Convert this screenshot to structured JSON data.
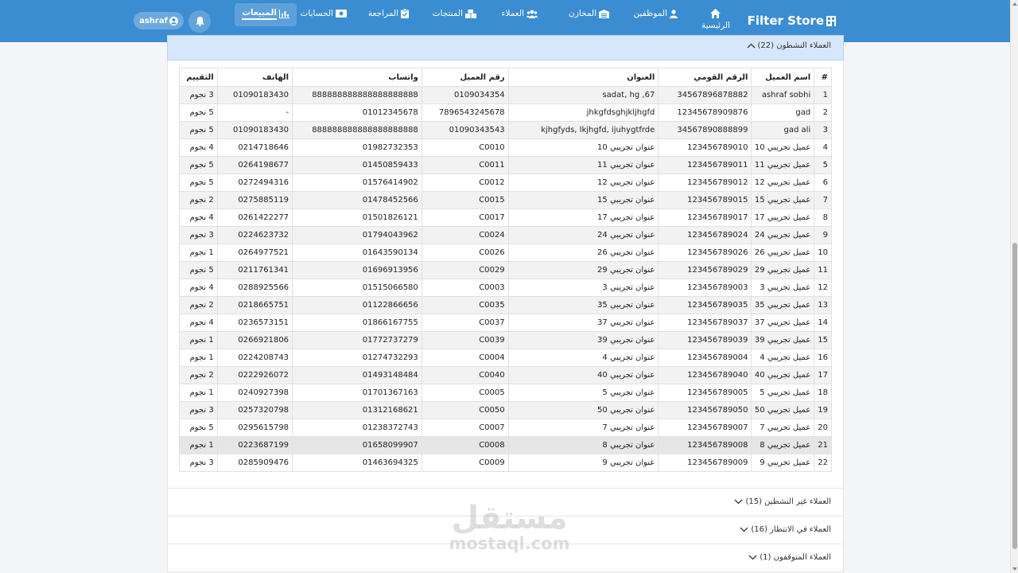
{
  "navbar": {
    "brand": "Filter Store",
    "home_label": "الرئيسية",
    "items": [
      {
        "label": "الموظفين",
        "icon": "user-icon"
      },
      {
        "label": "المخازن",
        "icon": "warehouse-icon"
      },
      {
        "label": "العملاء",
        "icon": "users-icon"
      },
      {
        "label": "المنتجات",
        "icon": "boxes-icon"
      },
      {
        "label": "المراجعة",
        "icon": "clipboard-icon"
      },
      {
        "label": "الحسابات",
        "icon": "money-icon"
      },
      {
        "label": "المبيعات",
        "icon": "chart-icon"
      }
    ],
    "user_name": "ashraf",
    "accent": "#3b8dd2"
  },
  "sections": {
    "active": "العملاء النشطون (22)",
    "inactive": "العملاء غير النشطين (15)",
    "waiting": "العملاء في الانتظار (16)",
    "stopped": "العملاء المتوقفون (1)"
  },
  "table": {
    "headers": [
      "#",
      "اسم العميل",
      "الرقم القومي",
      "العنوان",
      "رقم العميل",
      "واتساب",
      "الهاتف",
      "التقييم"
    ],
    "rows": [
      [
        "1",
        "ashraf sobhi",
        "34567896878882",
        "sadat, hg ,67",
        "0109034354",
        "888888888888888888888",
        "01090183430",
        "3 نجوم"
      ],
      [
        "2",
        "gad",
        "12345678909876",
        "jhkgfdsghjkljhgfd",
        "7896543245678",
        "01012345678",
        "-",
        "5 نجوم"
      ],
      [
        "3",
        "gad ali",
        "34567890888899",
        "kjhgfyds, lkjhgfd, ijuhygtfrde",
        "01090343543",
        "888888888888888888888",
        "01090183430",
        "5 نجوم"
      ],
      [
        "4",
        "عميل تجريبي 10",
        "123456789010",
        "عنوان تجريبي 10",
        "C0010",
        "01982732353",
        "0214718646",
        "4 نجوم"
      ],
      [
        "5",
        "عميل تجريبي 11",
        "123456789011",
        "عنوان تجريبي 11",
        "C0011",
        "01450859433",
        "0264198677",
        "5 نجوم"
      ],
      [
        "6",
        "عميل تجريبي 12",
        "123456789012",
        "عنوان تجريبي 12",
        "C0012",
        "01576414902",
        "0272494316",
        "5 نجوم"
      ],
      [
        "7",
        "عميل تجريبي 15",
        "123456789015",
        "عنوان تجريبي 15",
        "C0015",
        "01478452566",
        "0275885119",
        "2 نجوم"
      ],
      [
        "8",
        "عميل تجريبي 17",
        "123456789017",
        "عنوان تجريبي 17",
        "C0017",
        "01501826121",
        "0261422277",
        "4 نجوم"
      ],
      [
        "9",
        "عميل تجريبي 24",
        "123456789024",
        "عنوان تجريبي 24",
        "C0024",
        "01794043962",
        "0224623732",
        "3 نجوم"
      ],
      [
        "10",
        "عميل تجريبي 26",
        "123456789026",
        "عنوان تجريبي 26",
        "C0026",
        "01643590134",
        "0264977521",
        "1 نجوم"
      ],
      [
        "11",
        "عميل تجريبي 29",
        "123456789029",
        "عنوان تجريبي 29",
        "C0029",
        "01696913956",
        "0211761341",
        "5 نجوم"
      ],
      [
        "12",
        "عميل تجريبي 3",
        "123456789003",
        "عنوان تجريبي 3",
        "C0003",
        "01515066580",
        "0288925566",
        "4 نجوم"
      ],
      [
        "13",
        "عميل تجريبي 35",
        "123456789035",
        "عنوان تجريبي 35",
        "C0035",
        "01122866656",
        "0218665751",
        "2 نجوم"
      ],
      [
        "14",
        "عميل تجريبي 37",
        "123456789037",
        "عنوان تجريبي 37",
        "C0037",
        "01866167755",
        "0236573151",
        "4 نجوم"
      ],
      [
        "15",
        "عميل تجريبي 39",
        "123456789039",
        "عنوان تجريبي 39",
        "C0039",
        "01772737279",
        "0266921806",
        "1 نجوم"
      ],
      [
        "16",
        "عميل تجريبي 4",
        "123456789004",
        "عنوان تجريبي 4",
        "C0004",
        "01274732293",
        "0224208743",
        "1 نجوم"
      ],
      [
        "17",
        "عميل تجريبي 40",
        "123456789040",
        "عنوان تجريبي 40",
        "C0040",
        "01493148484",
        "0222926072",
        "2 نجوم"
      ],
      [
        "18",
        "عميل تجريبي 5",
        "123456789005",
        "عنوان تجريبي 5",
        "C0005",
        "01701367163",
        "0240927398",
        "1 نجوم"
      ],
      [
        "19",
        "عميل تجريبي 50",
        "123456789050",
        "عنوان تجريبي 50",
        "C0050",
        "01312168621",
        "0257320798",
        "3 نجوم"
      ],
      [
        "20",
        "عميل تجريبي 7",
        "123456789007",
        "عنوان تجريبي 7",
        "C0007",
        "01238372743",
        "0295615798",
        "5 نجوم"
      ],
      [
        "21",
        "عميل تجريبي 8",
        "123456789008",
        "عنوان تجريبي 8",
        "C0008",
        "01658099907",
        "0223687199",
        "1 نجوم"
      ],
      [
        "22",
        "عميل تجريبي 9",
        "123456789009",
        "عنوان تجريبي 9",
        "C0009",
        "01463694325",
        "0285909476",
        "3 نجوم"
      ]
    ]
  },
  "watermark": {
    "arabic": "مستقل",
    "latin": "mostaql.com"
  }
}
